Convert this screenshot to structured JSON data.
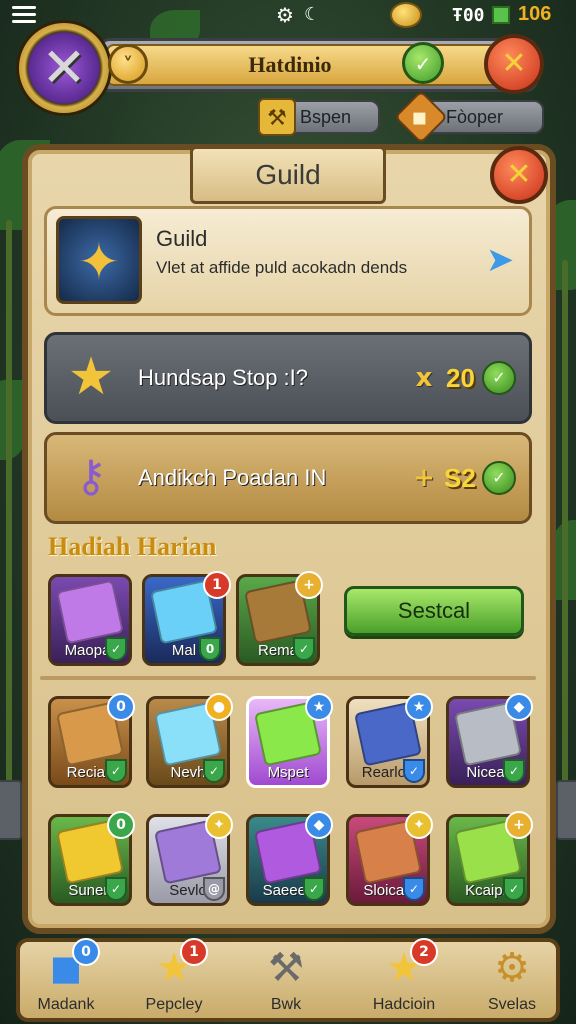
{
  "status_bar": {
    "resource_text": "Ŧ00",
    "gem_value": "106"
  },
  "header": {
    "title": "Hatdinio"
  },
  "tabs": [
    {
      "label": "Bspen",
      "icon": "hammer-icon"
    },
    {
      "label": "Fòoper",
      "icon": "chest-icon"
    }
  ],
  "panel": {
    "title": "Guild"
  },
  "guild_card": {
    "name": "Guild",
    "description": "Vlet at affide puld acokadn dends"
  },
  "rows": [
    {
      "label": "Hundsap Stop :I?",
      "currency_symbol": "x",
      "value": "20"
    },
    {
      "label": "Andikch Poadan IN",
      "currency_symbol": "+",
      "value": "S2"
    }
  ],
  "daily": {
    "title": "Hadiah Harian",
    "claim_label": "Sestcal",
    "items": [
      {
        "label": "Maopar",
        "icon": "purple-crystal-icon",
        "color": "#a35bd8"
      },
      {
        "label": "Mal",
        "icon": "blue-crystal-icon",
        "color": "#3f8ef0",
        "badge": "1"
      },
      {
        "label": "Rema",
        "icon": "chest-icon",
        "color": "#8a5a2a"
      }
    ]
  },
  "inventory": [
    {
      "label": "Recian",
      "icon": "gear-chest-icon",
      "color": "#b87830",
      "badge": "0"
    },
    {
      "label": "Nevh",
      "icon": "ice-crystal-icon",
      "color": "#6ad0f0"
    },
    {
      "label": "Mspet",
      "icon": "green-gem-icon",
      "color": "#7be04a",
      "badge": "★"
    },
    {
      "label": "Rearlon",
      "icon": "blue-gem-box-icon",
      "color": "#4a68c8",
      "badge": "★"
    },
    {
      "label": "Nicear",
      "icon": "anvil-icon",
      "color": "#8a92a0",
      "badge": "◆"
    },
    {
      "label": "Sunen",
      "icon": "gold-scroll-icon",
      "color": "#e8c030",
      "badge": "0"
    },
    {
      "label": "Sevlo",
      "icon": "purple-wagon-icon",
      "color": "#9a68d0"
    },
    {
      "label": "Saeeeti",
      "icon": "purple-pot-icon",
      "color": "#9a4ad0",
      "badge": "◆"
    },
    {
      "label": "Sloican",
      "icon": "crate-icon",
      "color": "#c8603a"
    },
    {
      "label": "Kcaiph",
      "icon": "green-shield-icon",
      "color": "#6ab84a",
      "badge": "+"
    }
  ],
  "bottom_nav": [
    {
      "label": "Madank",
      "icon": "blue-cube-icon",
      "badge": "0"
    },
    {
      "label": "Pepcley",
      "icon": "gold-star-icon",
      "badge": "1"
    },
    {
      "label": "Bwk",
      "icon": "hammer-icon"
    },
    {
      "label": "Hadcioin",
      "icon": "gold-star-icon",
      "badge": "2"
    },
    {
      "label": "Svelas",
      "icon": "gear-icon"
    }
  ]
}
